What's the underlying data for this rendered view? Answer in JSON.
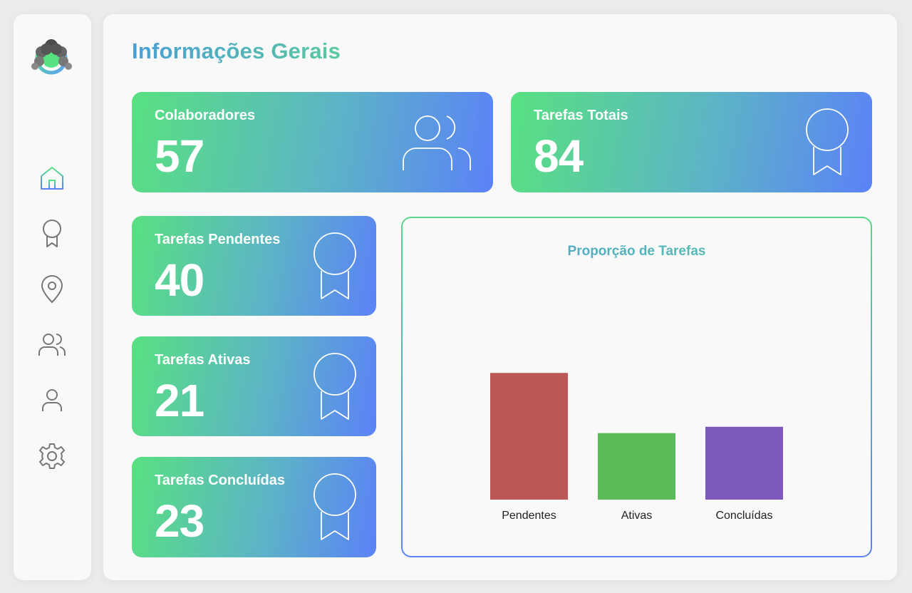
{
  "sidebar": {
    "logo": "logo-icon",
    "items": [
      {
        "name": "home",
        "icon": "home-icon",
        "active": true
      },
      {
        "name": "tasks",
        "icon": "award-icon",
        "active": false
      },
      {
        "name": "location",
        "icon": "map-pin-icon",
        "active": false
      },
      {
        "name": "team",
        "icon": "users-icon",
        "active": false
      },
      {
        "name": "profile",
        "icon": "user-icon",
        "active": false
      },
      {
        "name": "settings",
        "icon": "gear-icon",
        "active": false
      }
    ]
  },
  "header": {
    "title": "Informações Gerais"
  },
  "stats": {
    "colaboradores": {
      "label": "Colaboradores",
      "value": "57",
      "icon": "users-icon"
    },
    "total": {
      "label": "Tarefas Totais",
      "value": "84",
      "icon": "award-icon"
    },
    "pendentes": {
      "label": "Tarefas Pendentes",
      "value": "40",
      "icon": "award-icon"
    },
    "ativas": {
      "label": "Tarefas Ativas",
      "value": "21",
      "icon": "award-icon"
    },
    "concluidas": {
      "label": "Tarefas Concluídas",
      "value": "23",
      "icon": "award-icon"
    }
  },
  "colors": {
    "gradient_start": "#58e180",
    "gradient_end": "#5b82f7",
    "pendentes": "#bb5858",
    "ativas": "#5bbc59",
    "concluidas": "#7e59bc"
  },
  "chart_data": {
    "type": "bar",
    "title": "Proporção de Tarefas",
    "categories": [
      "Pendentes",
      "Ativas",
      "Concluídas"
    ],
    "values": [
      40,
      21,
      23
    ],
    "colors": [
      "#bb5858",
      "#5bbc59",
      "#7e59bc"
    ],
    "xlabel": "",
    "ylabel": "",
    "ylim": [
      0,
      45
    ],
    "grid": false,
    "legend": "none"
  }
}
